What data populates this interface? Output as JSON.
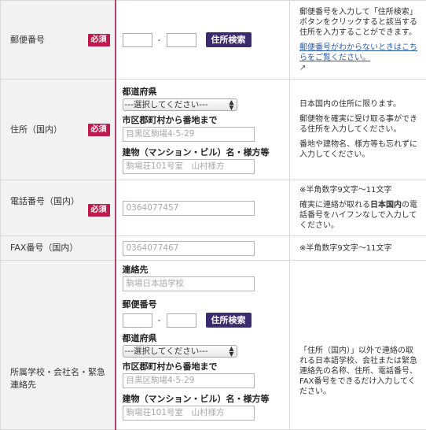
{
  "required_label": "必須",
  "search_button": "住所検索",
  "dash": "-",
  "rows": {
    "postal": {
      "label": "郵便番号",
      "note": "郵便番号を入力して「住所検索」ボタンをクリックすると該当する住所を入力することができます。",
      "link": "郵便番号がわからないときはこちらをご覧ください。"
    },
    "address": {
      "label": "住所（国内）",
      "prefecture_label": "都道府県",
      "prefecture_select": "---選択してください---",
      "city_label": "市区郡町村から番地まで",
      "city_placeholder": "目黒区駒場4-5-29",
      "building_label": "建物（マンション・ビル）名・様方等",
      "building_placeholder": "駒場荘101号室　山村様方",
      "note1": "日本国内の住所に限ります。",
      "note2": "郵便物を確実に受け取る事ができる住所を入力してください。",
      "note3": "番地や建物名、様方等も忘れずに入力してください。"
    },
    "phone": {
      "label": "電話番号（国内）",
      "placeholder": "0364077457",
      "note1": "※半角数字9文字〜11文字",
      "note2_pre": "確実に連絡が取れる",
      "note2_bold": "日本国内",
      "note2_post": "の電話番号をハイフンなしで入力してください。"
    },
    "fax": {
      "label": "FAX番号（国内）",
      "placeholder": "0364077467",
      "note": "※半角数字9文字〜11文字"
    },
    "school": {
      "label": "所属学校・会社名・緊急連絡先",
      "contact_label": "連絡先",
      "contact_placeholder": "駒場日本語学校",
      "postal_label": "郵便番号",
      "prefecture_label": "都道府県",
      "prefecture_select": "---選択してください---",
      "city_label": "市区郡町村から番地まで",
      "city_placeholder": "目黒区駒場4-5-29",
      "building_label": "建物（マンション・ビル）名・様方等",
      "building_placeholder": "駒場荘101号室　山村様方",
      "note": "「住所（国内）」以外で連絡の取れる日本語学校、会社または緊急連絡先の名称、住所、電話番号、FAX番号をできるだけ入力してください。"
    }
  }
}
